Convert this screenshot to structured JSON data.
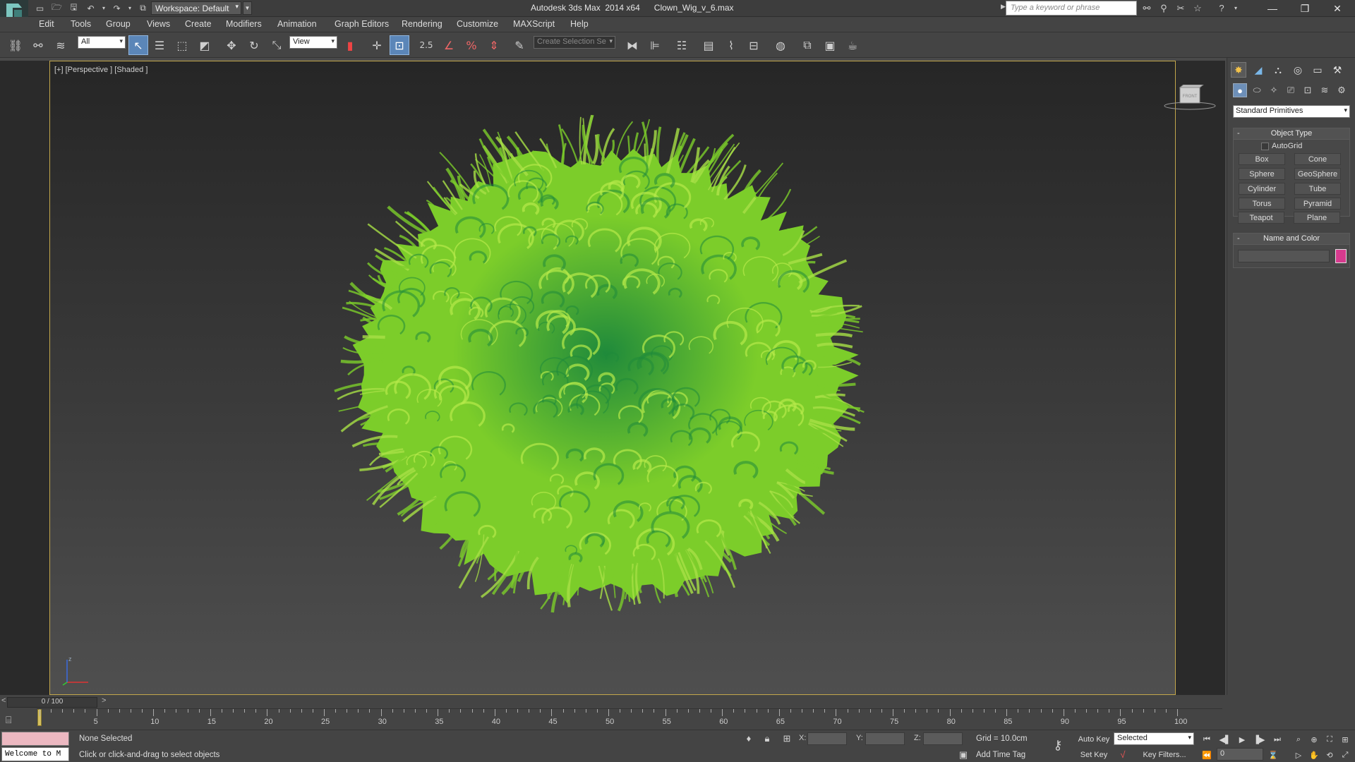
{
  "titlebar": {
    "app_logo": "3ds Max logo",
    "quick_access": [
      "new-icon",
      "open-icon",
      "save-icon",
      "undo-icon",
      "undo-dropdown-icon",
      "redo-icon",
      "redo-dropdown-icon",
      "project-folder-icon"
    ],
    "workspace_label": "Workspace: Default",
    "app_name": "Autodesk 3ds Max  2014 x64",
    "file_name": "Clown_Wig_v_6.max",
    "search_placeholder": "Type a keyword or phrase",
    "window_controls": [
      "minimize",
      "restore",
      "close"
    ]
  },
  "menu": {
    "items": [
      "Edit",
      "Tools",
      "Group",
      "Views",
      "Create",
      "Modifiers",
      "Animation",
      "Graph Editors",
      "Rendering",
      "Customize",
      "MAXScript",
      "Help"
    ]
  },
  "toolbar": {
    "filter_value": "All",
    "refcoord_value": "View",
    "snap_value": "2.5",
    "named_selection_placeholder": "Create Selection Se"
  },
  "viewport": {
    "label": "[+] [Perspective ] [Shaded ]",
    "viewcube_face": "FRONT",
    "object_color": "#7ccd2a",
    "object_shade_dark": "#1f8a3b",
    "axis_labels": {
      "x": "x",
      "y": "y",
      "z": "z"
    }
  },
  "timeline": {
    "slider_text": "0 / 100",
    "prev": "<",
    "next": ">",
    "labels": [
      "5",
      "10",
      "15",
      "20",
      "25",
      "30",
      "35",
      "40",
      "45",
      "50",
      "55",
      "60",
      "65",
      "70",
      "75",
      "80",
      "85",
      "90",
      "95",
      "100"
    ],
    "frame_start": 0,
    "frame_end": 100,
    "current_frame": 0
  },
  "status": {
    "listener_text": "Welcome to M",
    "selection_status": "None Selected",
    "prompt": "Click or click-and-drag to select objects",
    "x_label": "X:",
    "y_label": "Y:",
    "z_label": "Z:",
    "grid": "Grid = 10.0cm",
    "add_time_tag": "Add Time Tag",
    "auto_key": "Auto Key",
    "set_key": "Set Key",
    "selected_dropdown": "Selected",
    "key_filters": "Key Filters...",
    "frame_value": "0"
  },
  "command_panel": {
    "tabs": [
      "create-tab",
      "modify-tab",
      "hierarchy-tab",
      "motion-tab",
      "display-tab",
      "utilities-tab"
    ],
    "subtabs": [
      "geometry",
      "shapes",
      "lights",
      "cameras",
      "helpers",
      "space-warps",
      "systems"
    ],
    "category": "Standard Primitives",
    "object_type": {
      "title": "Object Type",
      "autogrid": "AutoGrid",
      "buttons": [
        "Box",
        "Cone",
        "Sphere",
        "GeoSphere",
        "Cylinder",
        "Tube",
        "Torus",
        "Pyramid",
        "Teapot",
        "Plane"
      ]
    },
    "name_color": {
      "title": "Name and Color",
      "name_value": "",
      "color": "#d63a8e"
    },
    "collapse_glyph": "-"
  }
}
